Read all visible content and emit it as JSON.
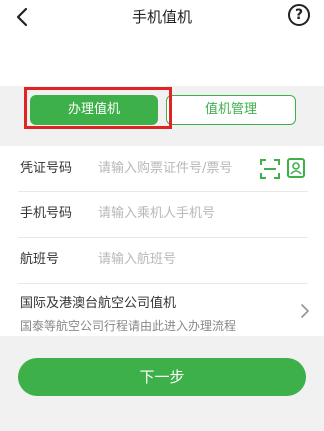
{
  "header": {
    "title": "手机值机",
    "help_symbol": "?"
  },
  "tabs": [
    {
      "label": "办理值机",
      "active": true
    },
    {
      "label": "值机管理",
      "active": false
    }
  ],
  "form": {
    "fields": [
      {
        "label": "凭证号码",
        "placeholder": "请输入购票证件号/票号"
      },
      {
        "label": "手机号码",
        "placeholder": "请输入乘机人手机号"
      },
      {
        "label": "航班号",
        "placeholder": "请输入航班号"
      }
    ]
  },
  "intl": {
    "title": "国际及港澳台航空公司值机",
    "subtitle": "国泰等航空公司行程请由此进入办理流程"
  },
  "next_button": {
    "label": "下一步"
  },
  "colors": {
    "accent": "#3db04a",
    "highlight": "#e02424",
    "band": "#f1f1f1"
  }
}
